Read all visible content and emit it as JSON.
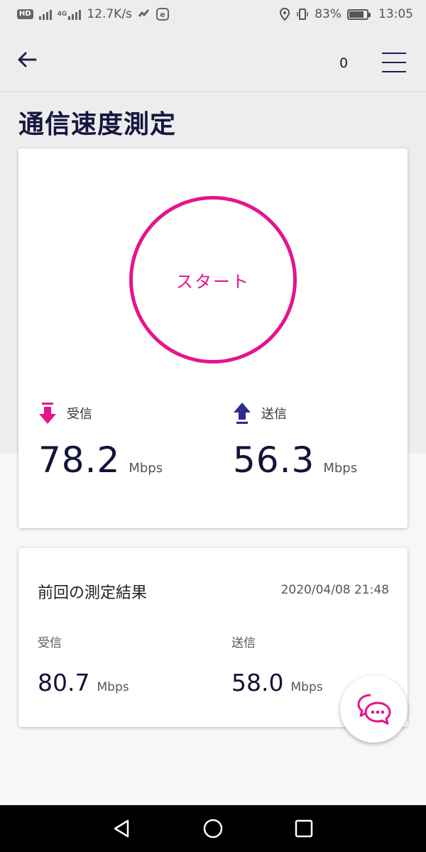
{
  "status_bar": {
    "network_speed": "12.7K/s",
    "network_tag": "4G",
    "battery": "83%",
    "time": "13:05",
    "icons": [
      "hd-icon",
      "signal-icon",
      "signal-4g-icon",
      "stock-app-icon",
      "e-app-icon",
      "location-icon",
      "vibrate-icon",
      "battery-icon"
    ]
  },
  "app_bar": {
    "back_icon": "arrow-left-icon",
    "notification_count": "0",
    "menu_icon": "hamburger-menu-icon"
  },
  "page": {
    "title": "通信速度測定"
  },
  "speed_test": {
    "start_label": "スタート",
    "download": {
      "label": "受信",
      "value": "78.2",
      "unit": "Mbps",
      "icon": "download-arrow-icon",
      "color": "#e5148c"
    },
    "upload": {
      "label": "送信",
      "value": "56.3",
      "unit": "Mbps",
      "icon": "upload-arrow-icon",
      "color": "#2f2a8f"
    }
  },
  "previous_result": {
    "title": "前回の測定結果",
    "datetime": "2020/04/08 21:48",
    "download": {
      "label": "受信",
      "value": "80.7",
      "unit": "Mbps"
    },
    "upload": {
      "label": "送信",
      "value": "58.0",
      "unit": "Mbps"
    }
  },
  "chat_button": {
    "icon": "chat-bubbles-icon"
  },
  "nav_bar": {
    "buttons": [
      "back-triangle-icon",
      "home-circle-icon",
      "recents-square-icon"
    ]
  },
  "colors": {
    "accent": "#e5148c",
    "primary_text": "#13133a",
    "upload_arrow": "#2f2a8f"
  }
}
